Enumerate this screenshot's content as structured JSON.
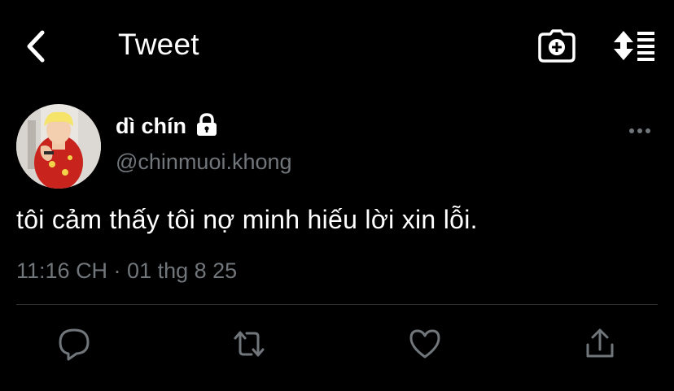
{
  "header": {
    "title": "Tweet",
    "back_icon": "chevron-left-icon",
    "camera_icon": "camera-add-icon",
    "sort_icon": "sort-list-icon"
  },
  "tweet": {
    "display_name": "dì chín",
    "handle": "@chinmuoi.khong",
    "protected": true,
    "text": "tôi cảm thấy tôi nợ minh hiếu lời xin lỗi.",
    "timestamp": "11:16 CH · 01 thg 8 25"
  },
  "actions": [
    {
      "name": "reply",
      "icon": "reply-icon"
    },
    {
      "name": "retweet",
      "icon": "retweet-icon"
    },
    {
      "name": "like",
      "icon": "heart-icon"
    },
    {
      "name": "share",
      "icon": "share-icon"
    }
  ],
  "colors": {
    "background": "#000000",
    "text": "#ffffff",
    "secondary_text": "#71767b",
    "divider": "#2f3336"
  }
}
